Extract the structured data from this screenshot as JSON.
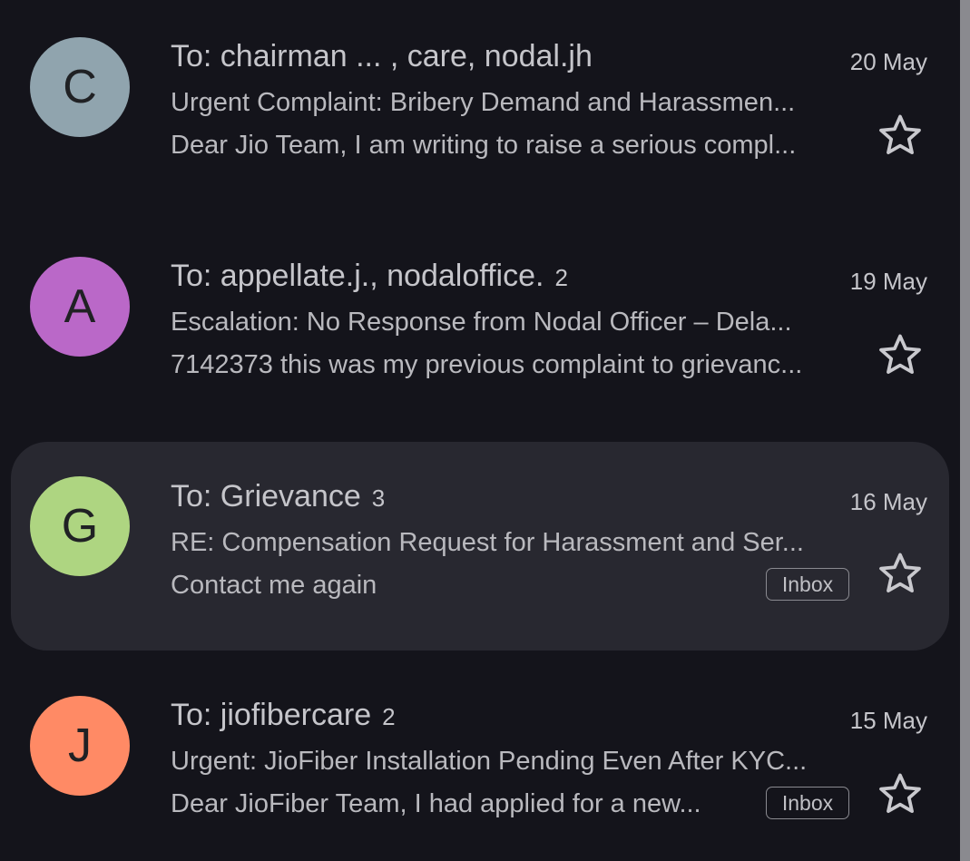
{
  "emails": [
    {
      "avatar_letter": "C",
      "avatar_color": "#90a4ae",
      "sender": "To: chairman ... , care, nodal.jh",
      "count": "",
      "date": "20 May",
      "subject": "Urgent Complaint: Bribery Demand and Harassmen...",
      "snippet": "Dear Jio Team, I am writing to raise a serious compl...",
      "label": "",
      "starred": false,
      "star_icon": "star-outline-icon"
    },
    {
      "avatar_letter": "A",
      "avatar_color": "#ba68c8",
      "sender": "To: appellate.j., nodaloffice.",
      "count": "2",
      "date": "19 May",
      "subject": "Escalation: No Response from Nodal Officer – Dela...",
      "snippet": "7142373 this was my previous complaint to grievanc...",
      "label": "",
      "starred": false,
      "star_icon": "star-outline-icon"
    },
    {
      "avatar_letter": "G",
      "avatar_color": "#aed581",
      "sender": "To: Grievance",
      "count": "3",
      "date": "16 May",
      "subject": "RE: Compensation Request for Harassment and Ser...",
      "snippet": "Contact me again",
      "label": "Inbox",
      "starred": false,
      "selected": true,
      "star_icon": "star-outline-icon"
    },
    {
      "avatar_letter": "J",
      "avatar_color": "#ff8a65",
      "sender": "To: jiofibercare",
      "count": "2",
      "date": "15 May",
      "subject": "Urgent: JioFiber Installation Pending Even After KYC...",
      "snippet": "Dear JioFiber Team, I had applied for a new...",
      "label": "Inbox",
      "starred": false,
      "star_icon": "star-outline-icon"
    }
  ],
  "colors": {
    "background": "#14141b",
    "selected_row": "#282830",
    "text": "#c5c5ca"
  }
}
